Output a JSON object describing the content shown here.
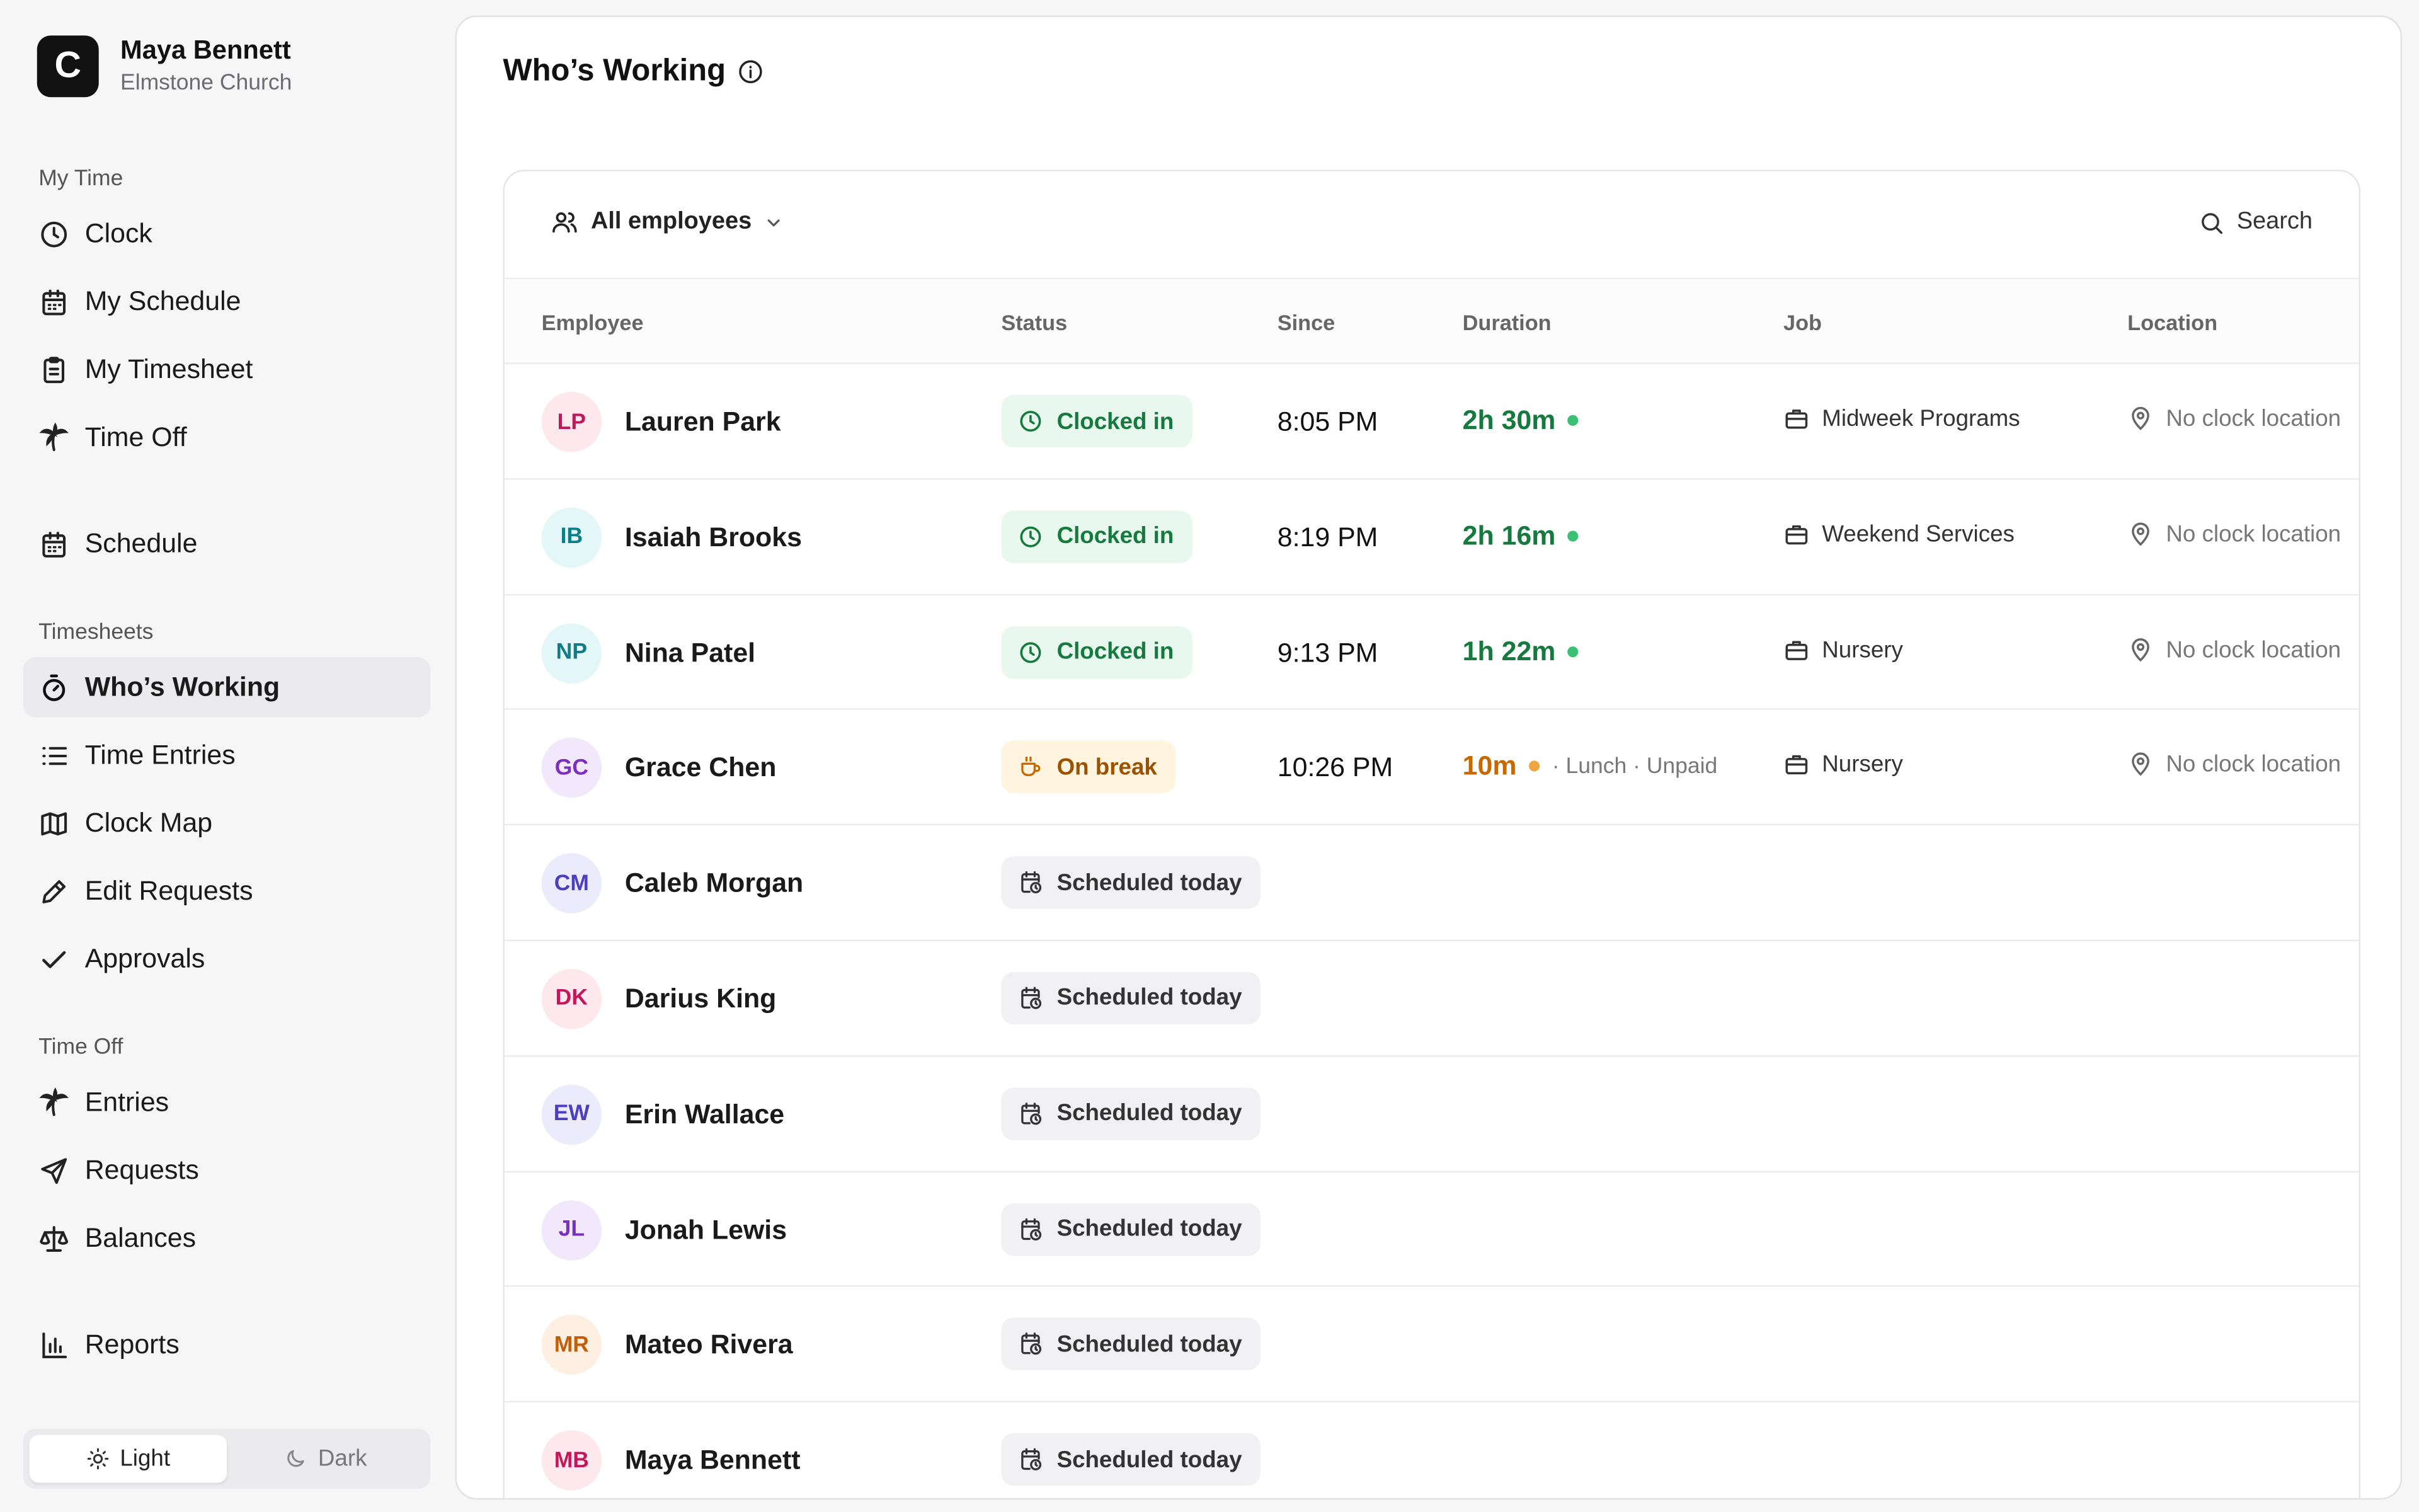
{
  "brand": {
    "logo_letter": "C",
    "user_name": "Maya Bennett",
    "org_name": "Elmstone Church"
  },
  "sidebar": {
    "sections": {
      "my_time": "My Time",
      "timesheets": "Timesheets",
      "time_off": "Time Off"
    },
    "items": {
      "clock": "Clock",
      "my_schedule": "My Schedule",
      "my_timesheet": "My Timesheet",
      "time_off": "Time Off",
      "schedule": "Schedule",
      "whos_working": "Who’s Working",
      "time_entries": "Time Entries",
      "clock_map": "Clock Map",
      "edit_requests": "Edit Requests",
      "approvals": "Approvals",
      "entries": "Entries",
      "requests": "Requests",
      "balances": "Balances",
      "reports": "Reports"
    },
    "theme": {
      "light": "Light",
      "dark": "Dark",
      "selected": "Light"
    }
  },
  "page": {
    "title": "Who’s Working"
  },
  "toolbar": {
    "filter_label": "All employees",
    "search_label": "Search"
  },
  "table": {
    "columns": {
      "employee": "Employee",
      "status": "Status",
      "since": "Since",
      "duration": "Duration",
      "job": "Job",
      "location": "Location"
    },
    "rows": [
      {
        "initials": "LP",
        "name": "Lauren Park",
        "status": "Clocked in",
        "since": "8:05 PM",
        "duration": "2h 30m",
        "duration_note": "",
        "job": "Midweek Programs",
        "location": "No clock location"
      },
      {
        "initials": "IB",
        "name": "Isaiah Brooks",
        "status": "Clocked in",
        "since": "8:19 PM",
        "duration": "2h 16m",
        "duration_note": "",
        "job": "Weekend Services",
        "location": "No clock location"
      },
      {
        "initials": "NP",
        "name": "Nina Patel",
        "status": "Clocked in",
        "since": "9:13 PM",
        "duration": "1h 22m",
        "duration_note": "",
        "job": "Nursery",
        "location": "No clock location"
      },
      {
        "initials": "GC",
        "name": "Grace Chen",
        "status": "On break",
        "since": "10:26 PM",
        "duration": "10m",
        "duration_note": "· Lunch · Unpaid",
        "job": "Nursery",
        "location": "No clock location"
      },
      {
        "initials": "CM",
        "name": "Caleb Morgan",
        "status": "Scheduled today"
      },
      {
        "initials": "DK",
        "name": "Darius King",
        "status": "Scheduled today"
      },
      {
        "initials": "EW",
        "name": "Erin Wallace",
        "status": "Scheduled today"
      },
      {
        "initials": "JL",
        "name": "Jonah Lewis",
        "status": "Scheduled today"
      },
      {
        "initials": "MR",
        "name": "Mateo Rivera",
        "status": "Scheduled today"
      },
      {
        "initials": "MB",
        "name": "Maya Bennett",
        "status": "Scheduled today"
      }
    ]
  },
  "colors": {
    "accent_green": "#167a3e",
    "accent_orange": "#c66a00",
    "avatar_pink_bg": "#fde8ee",
    "avatar_pink_fg": "#c2185b",
    "avatar_teal_bg": "#e3f6f8",
    "avatar_teal_fg": "#0f7c8a",
    "avatar_purple_bg": "#f1e9fb",
    "avatar_purple_fg": "#7b2fbe",
    "avatar_indigo_bg": "#ecebfb",
    "avatar_indigo_fg": "#4b3fbf",
    "avatar_orange_bg": "#fdf0e2",
    "avatar_orange_fg": "#c0600b"
  }
}
